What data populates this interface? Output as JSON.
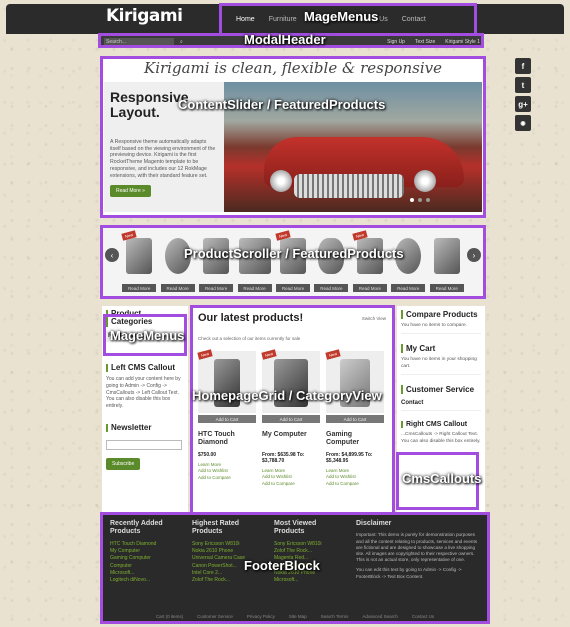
{
  "logo": "Kirigami",
  "nav": [
    "Home",
    "Furniture",
    "Electronics",
    "About Us",
    "Contact"
  ],
  "search_placeholder": "Search...",
  "utility": [
    "Sign Up",
    "Text Size",
    "Kirigami Style 1"
  ],
  "social": [
    "f",
    "t",
    "g+",
    "rss"
  ],
  "hero": {
    "tagline": "Kirigami is clean, flexible & responsive",
    "title": "Responsive Layout.",
    "body": "A Responsive theme automatically adapts itself based on the viewing environment of the previewing device. Kirigami is the first RocketTheme Magento template to be responsive, and includes our 12 RokMage extensions, with their standard feature set.",
    "button": "Read More »"
  },
  "scroller": {
    "items": [
      "Read More",
      "Read More",
      "Read More",
      "Read More",
      "Read More",
      "Read More",
      "Read More",
      "Read More",
      "Read More",
      "Read More"
    ],
    "badge": "New"
  },
  "left": {
    "categories_title": "Product Categories",
    "root_catalog": "Root Catalog",
    "callout_title": "Left CMS Callout",
    "callout_body": "You can add your content here by going to Admin -> Config -> CmsCallouts -> Left Callout Text. You can also disable this box entirely.",
    "newsletter_title": "Newsletter",
    "subscribe": "Subscribe"
  },
  "main": {
    "title": "Our latest products!",
    "switch": "Switch View",
    "subtitle": "Check out a selection of our items currently for sale",
    "add_to_cart": "Add to Cart",
    "products": [
      {
        "name": "HTC Touch Diamond",
        "price": "$750.00",
        "links": [
          "Learn More",
          "Add to Wishlist",
          "Add to Compare"
        ]
      },
      {
        "name": "My Computer",
        "price": "From: $635.98 To: $3,788.70",
        "links": [
          "Learn More",
          "Add to Wishlist",
          "Add to Compare"
        ]
      },
      {
        "name": "Gaming Computer",
        "price": "From: $4,899.95 To: $5,348.95",
        "links": [
          "Learn More",
          "Add to Wishlist",
          "Add to Compare"
        ]
      }
    ]
  },
  "right": {
    "compare_title": "Compare Products",
    "compare_text": "You have no items to compare.",
    "cart_title": "My Cart",
    "cart_text": "You have no items in your shopping cart.",
    "service_title": "Customer Service",
    "contact": "Contact",
    "callout_title": "Right CMS Callout",
    "callout_body": "...CmsCallouts -> Right Callout Text. You can also disable this box entirely."
  },
  "footer": {
    "recent_title": "Recently Added Products",
    "recent": [
      "HTC Touch Diamond",
      "My Computer",
      "Gaming Computer",
      "Computer",
      "Microsoft...",
      "Logitech diNovo..."
    ],
    "rated_title": "Highest Rated Products",
    "rated": [
      "Sony Ericsson W810i",
      "Nokia 2610 Phone",
      "Universal Camera Case",
      "Canon PowerShot...",
      "Intel Core 2...",
      "Zolof The Rock..."
    ],
    "viewed_title": "Most Viewed Products",
    "viewed": [
      "Sony Ericsson W810i",
      "Zolof The Rock...",
      "Magenta Red...",
      "Sony VAIO VGN...",
      "Nokia 2610 Phone",
      "Microsoft..."
    ],
    "disclaimer_title": "Disclaimer",
    "disclaimer_text": "Important: This demo is purely for demonstration purposes and all the content relating to products, services and events are fictional and are designed to showcase a live shopping site. All images are copyrighted to their respective owners. This is not an actual store, only representative of one.",
    "disclaimer_edit": "You can edit this text by going to Admin -> Config -> FooterBlock -> Text Box Content.",
    "links": [
      "Cart (0 items)",
      "Customer Service",
      "Privacy Policy",
      "Site Map",
      "Search Terms",
      "Advanced Search",
      "Contact Us"
    ]
  },
  "annotations": {
    "mage_menus_top": "MageMenus",
    "modal_header": "ModalHeader",
    "content_slider": "ContentSlider / FeaturedProducts",
    "product_scroller": "ProductScroller / FeaturedProducts",
    "mage_menus_left": "MageMenus",
    "homepage_grid": "HomepageGrid / CategoryView",
    "cms_callouts": "CmsCallouts",
    "footer_block": "FooterBlock"
  }
}
